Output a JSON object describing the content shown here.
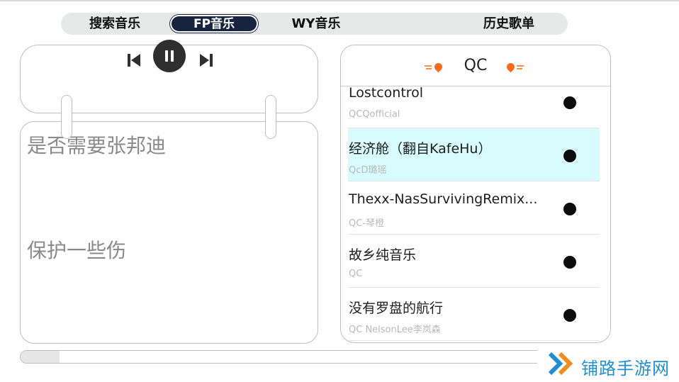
{
  "tabs": [
    {
      "label": "搜索音乐",
      "active": false
    },
    {
      "label": "FP音乐",
      "active": true
    },
    {
      "label": "WY音乐",
      "active": false
    },
    {
      "label": "历史歌单",
      "active": false
    }
  ],
  "player": {
    "prev_icon": "skip-previous-icon",
    "pause_icon": "pause-icon",
    "next_icon": "skip-next-icon"
  },
  "lyrics": {
    "line1": "是否需要张邦迪",
    "line2": "保护一些伤"
  },
  "playlist": {
    "title": "QC",
    "songs": [
      {
        "title": "Lostcontrol",
        "artist": "QCQofficial",
        "active": false
      },
      {
        "title": "经济舱（翻自KafeHu）",
        "artist": "QcD璐瑶",
        "active": true
      },
      {
        "title": "Thexx-NasSurvivingRemix...",
        "artist": "QC-琴橙",
        "active": false
      },
      {
        "title": "故乡纯音乐",
        "artist": "QC",
        "active": false
      },
      {
        "title": "没有罗盘的航行",
        "artist": "QC NelsonLee李岚森",
        "active": false
      }
    ]
  },
  "progress": {
    "fraction": 0.075
  },
  "watermark": {
    "text": "铺路手游网"
  },
  "colors": {
    "tab_active_bg": "#17233f",
    "active_row_bg": "#d8fbfe",
    "flame": "#ff6a1a",
    "watermark": "#1e8fd6"
  }
}
